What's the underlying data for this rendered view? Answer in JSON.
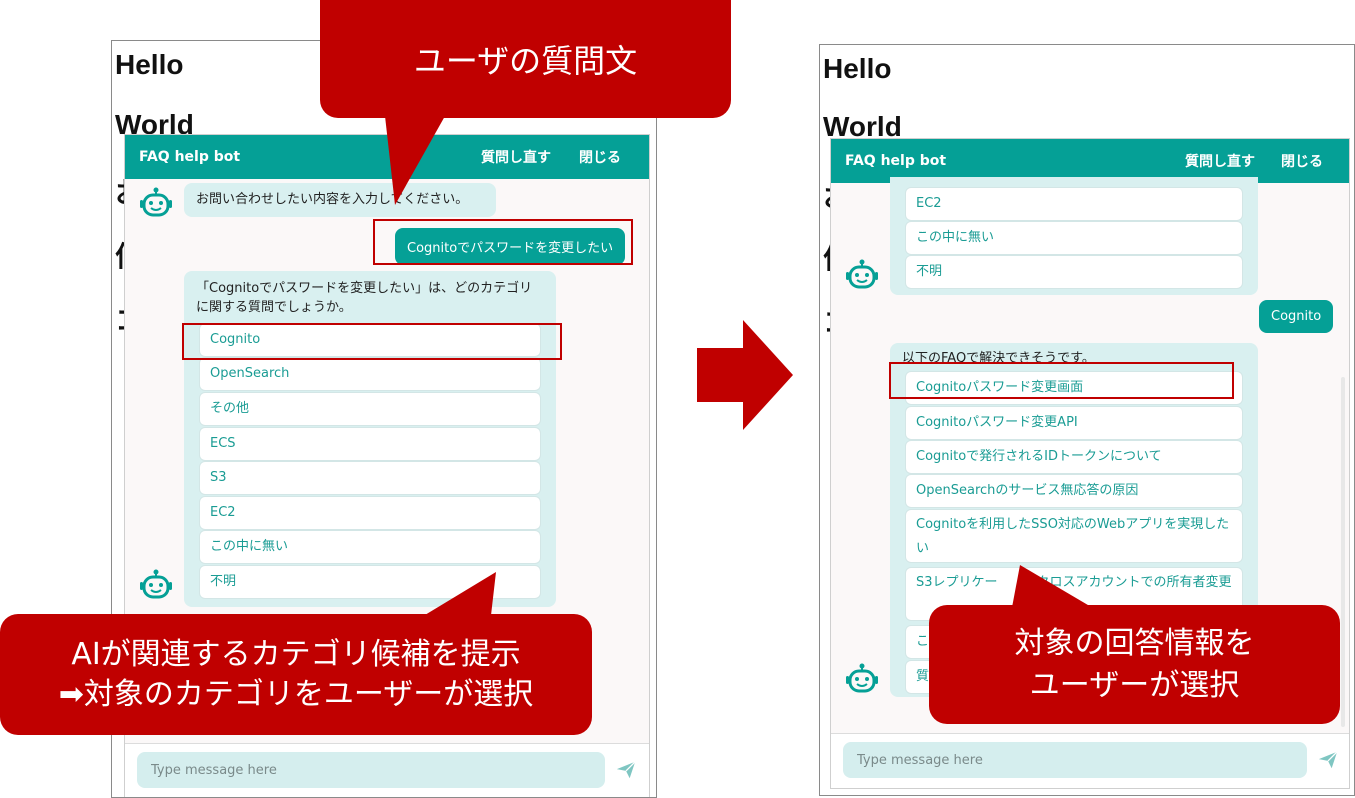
{
  "page": {
    "headings": [
      "Hello",
      "World"
    ],
    "partial_glyphs": [
      "お",
      "何",
      "コ"
    ]
  },
  "bot": {
    "title": "FAQ help bot",
    "retry_label": "質問し直す",
    "close_label": "閉じる",
    "input_placeholder": "Type message here"
  },
  "left_chat": {
    "greeting": "お問い合わせしたい内容を入力してください。",
    "user_message": "Cognitoでパスワードを変更したい",
    "category_prompt": "「Cognitoでパスワードを変更したい」は、どのカテゴリに関する質問でしょうか。",
    "categories": [
      "Cognito",
      "OpenSearch",
      "その他",
      "ECS",
      "S3",
      "EC2",
      "この中に無い",
      "不明"
    ]
  },
  "right_chat": {
    "prev_options": [
      "EC2",
      "この中に無い",
      "不明"
    ],
    "user_message": "Cognito",
    "answer_prompt": "以下のFAQで解決できそうです。",
    "faq_items": [
      "Cognitoパスワード変更画面",
      "Cognitoパスワード変更API",
      "Cognitoで発行されるIDトークンについて",
      "OpenSearchのサービス無応答の原因",
      "Cognitoを利用したSSO対応のWebアプリを実現したい",
      "S3レプリケー　　　クロスアカウントでの所有者変更",
      "この",
      "質問"
    ]
  },
  "callouts": {
    "question": "ユーザの質問文",
    "category_line1": "AIが関連するカテゴリ候補を提示",
    "category_line2": "➡対象のカテゴリをユーザーが選択",
    "answer_line1": "対象の回答情報を",
    "answer_line2": "ユーザーが選択"
  },
  "colors": {
    "teal": "#05a096",
    "bubble": "#d9f0f0",
    "callout_red": "#c00000"
  }
}
